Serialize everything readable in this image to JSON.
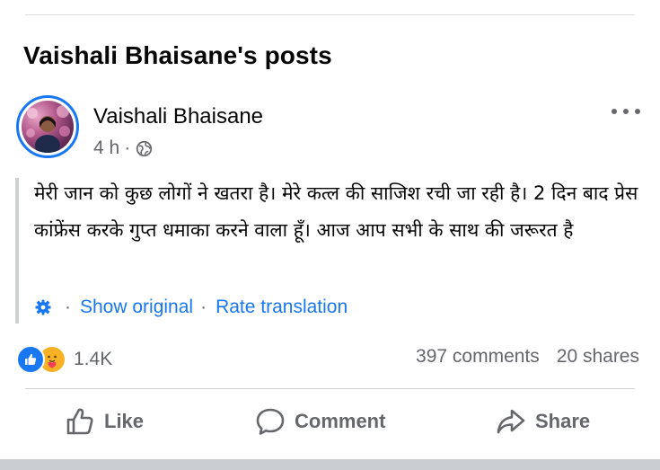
{
  "section": {
    "title": "Vaishali Bhaisane's posts"
  },
  "post": {
    "author": "Vaishali Bhaisane",
    "time": "4 h",
    "separator": "·",
    "text": "मेरी जान को कुछ लोगों ने खतरा है। मेरे कत्ल की साजिश रची जा रही है। 2 दिन बाद प्रेस कांफ्रेंस करके गुप्त धमाका करने वाला हूँ। आज आप सभी के साथ की जरूरत है",
    "translation": {
      "dot1": "·",
      "show_original": "Show original",
      "dot2": "·",
      "rate": "Rate translation"
    },
    "reactions_count": "1.4K",
    "comments": "397 comments",
    "shares": "20 shares"
  },
  "actions": {
    "like": "Like",
    "comment": "Comment",
    "share": "Share"
  },
  "icons": [
    "globe-icon",
    "more-icon",
    "gear-icon",
    "like-reaction-icon",
    "care-reaction-icon",
    "thumbs-up-icon",
    "comment-icon",
    "share-icon"
  ],
  "colors": {
    "accent": "#1877f2",
    "muted": "#65676b",
    "care": "#f7b125"
  }
}
